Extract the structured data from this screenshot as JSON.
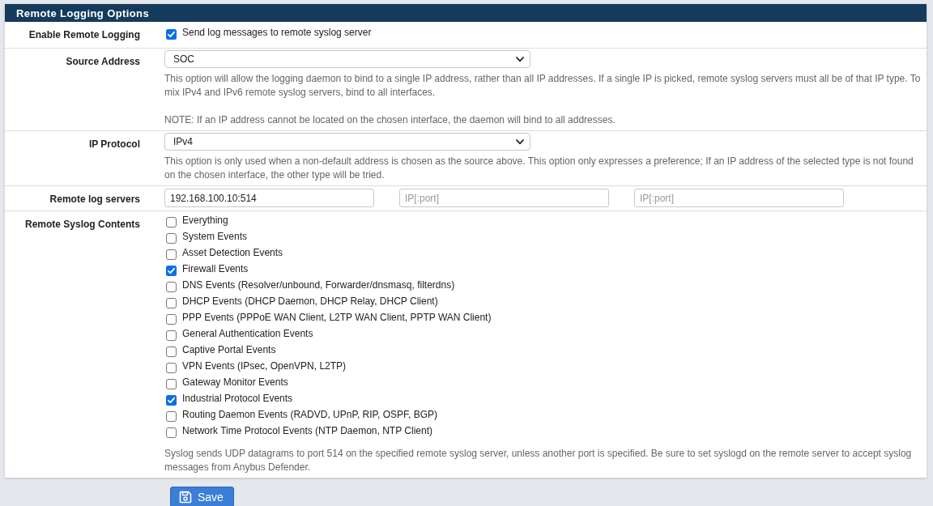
{
  "panel": {
    "title": "Remote Logging Options"
  },
  "rows": [
    {
      "kind": "checkbox",
      "label": "Enable Remote Logging",
      "checked": true,
      "text": "Send log messages to remote syslog server"
    },
    {
      "kind": "select",
      "label": "Source Address",
      "value": "SOC",
      "help": [
        "This option will allow the logging daemon to bind to a single IP address, rather than all IP addresses. If a single IP is picked, remote syslog servers must all be of that IP type. To mix IPv4 and IPv6 remote syslog servers, bind to all interfaces.",
        "NOTE: If an IP address cannot be located on the chosen interface, the daemon will bind to all addresses."
      ]
    },
    {
      "kind": "select",
      "label": "IP Protocol",
      "value": "IPv4",
      "help": [
        "This option is only used when a non-default address is chosen as the source above. This option only expresses a preference; If an IP address of the selected type is not found on the chosen interface, the other type will be tried."
      ]
    },
    {
      "kind": "inputs",
      "label": "Remote log servers",
      "fields": [
        {
          "value": "192.168.100.10:514"
        },
        {
          "placeholder": "IP[:port]"
        },
        {
          "placeholder": "IP[:port]"
        }
      ]
    },
    {
      "kind": "checklist",
      "label": "Remote Syslog Contents",
      "options": [
        {
          "label": "Everything",
          "checked": false
        },
        {
          "label": "System Events",
          "checked": false
        },
        {
          "label": "Asset Detection Events",
          "checked": false
        },
        {
          "label": "Firewall Events",
          "checked": true
        },
        {
          "label": "DNS Events (Resolver/unbound, Forwarder/dnsmasq, filterdns)",
          "checked": false
        },
        {
          "label": "DHCP Events (DHCP Daemon, DHCP Relay, DHCP Client)",
          "checked": false
        },
        {
          "label": "PPP Events (PPPoE WAN Client, L2TP WAN Client, PPTP WAN Client)",
          "checked": false
        },
        {
          "label": "General Authentication Events",
          "checked": false
        },
        {
          "label": "Captive Portal Events",
          "checked": false
        },
        {
          "label": "VPN Events (IPsec, OpenVPN, L2TP)",
          "checked": false
        },
        {
          "label": "Gateway Monitor Events",
          "checked": false
        },
        {
          "label": "Industrial Protocol Events",
          "checked": true
        },
        {
          "label": "Routing Daemon Events (RADVD, UPnP, RIP, OSPF, BGP)",
          "checked": false
        },
        {
          "label": "Network Time Protocol Events (NTP Daemon, NTP Client)",
          "checked": false
        }
      ],
      "help": [
        "Syslog sends UDP datagrams to port 514 on the specified remote syslog server, unless another port is specified. Be sure to set syslogd on the remote server to accept syslog messages from Anybus Defender."
      ]
    }
  ],
  "save_button": {
    "label": "Save"
  }
}
